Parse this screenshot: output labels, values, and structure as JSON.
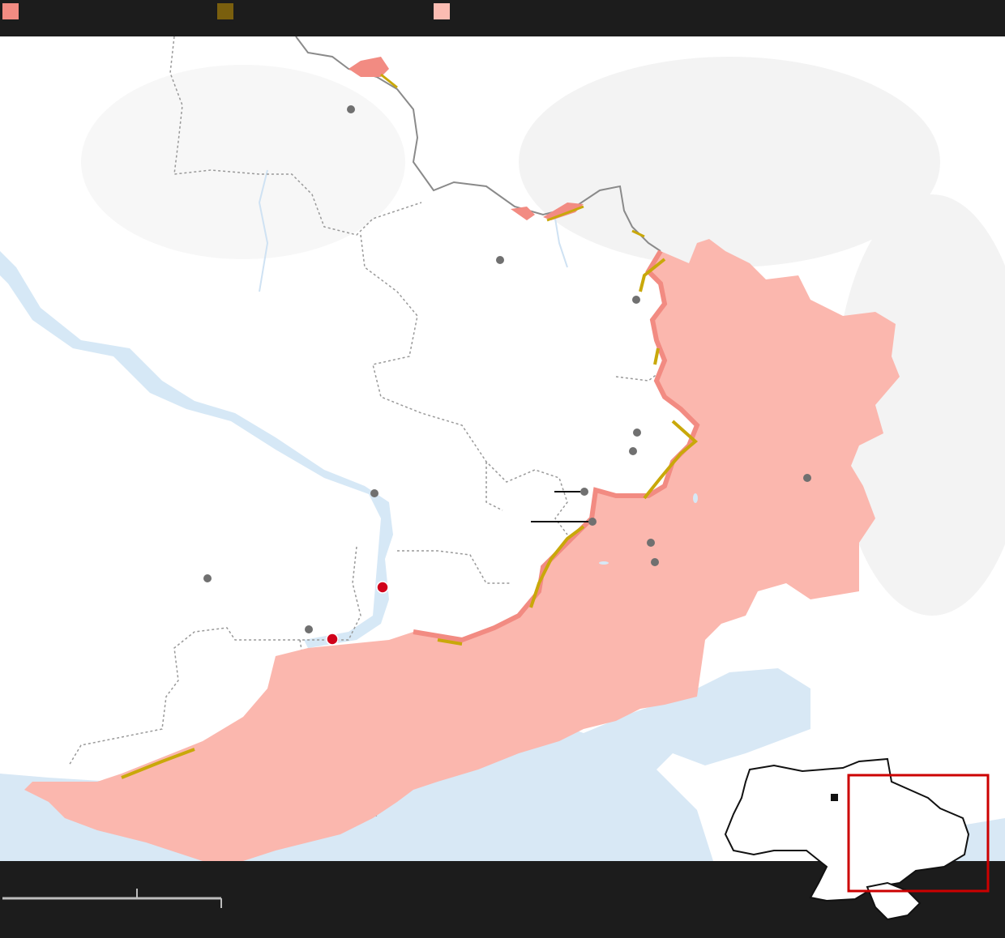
{
  "legend": {
    "items": [
      {
        "label": "",
        "color": "#f28b82"
      },
      {
        "label": "",
        "color": "#7a5f0e"
      },
      {
        "label": "",
        "color": "#fbbcb2"
      }
    ]
  },
  "colors": {
    "occupied": "#fbb7ae",
    "advance": "#c9a80a",
    "recent": "#f28b82",
    "water": "#d7e8f5",
    "city": "#777777",
    "attack": "#cc0000",
    "border": "#9a9a9a",
    "inset_frame": "#cc0000"
  },
  "cities": [
    {
      "name": "",
      "kind": "city"
    },
    {
      "name": "",
      "kind": "city"
    },
    {
      "name": "",
      "kind": "city"
    },
    {
      "name": "",
      "kind": "city"
    },
    {
      "name": "",
      "kind": "city"
    },
    {
      "name": "",
      "kind": "city"
    },
    {
      "name": "",
      "kind": "city"
    },
    {
      "name": "",
      "kind": "city"
    },
    {
      "name": "",
      "kind": "city"
    },
    {
      "name": "",
      "kind": "city"
    },
    {
      "name": "",
      "kind": "city"
    },
    {
      "name": "",
      "kind": "city"
    },
    {
      "name": "",
      "kind": "city"
    },
    {
      "name": "",
      "kind": "attack"
    },
    {
      "name": "",
      "kind": "attack"
    }
  ],
  "scale_bar": {
    "label": ""
  },
  "inset": {
    "label": "",
    "capital_marker": "square-marker"
  }
}
